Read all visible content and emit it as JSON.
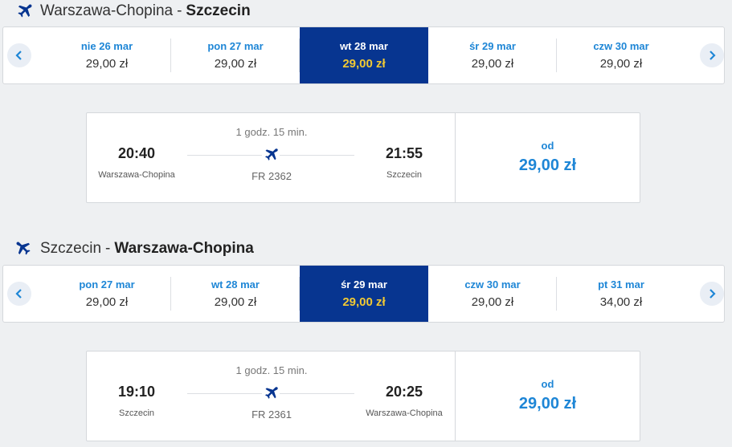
{
  "colors": {
    "accent": "#1e86d6",
    "selected_bg": "#073590",
    "selected_price": "#f1c933"
  },
  "outbound": {
    "origin": "Warszawa-Chopina",
    "separator": "-",
    "destination": "Szczecin",
    "days": [
      {
        "label": "nie 26 mar",
        "price": "29,00 zł"
      },
      {
        "label": "pon 27 mar",
        "price": "29,00 zł"
      },
      {
        "label": "wt 28 mar",
        "price": "29,00 zł"
      },
      {
        "label": "śr 29 mar",
        "price": "29,00 zł"
      },
      {
        "label": "czw 30 mar",
        "price": "29,00 zł"
      }
    ],
    "selected_day": "wt 28 mar",
    "flight": {
      "duration": "1 godz. 15 min.",
      "dep_time": "20:40",
      "dep_city": "Warszawa-Chopina",
      "arr_time": "21:55",
      "arr_city": "Szczecin",
      "flight_number": "FR 2362",
      "from_label": "od",
      "price": "29,00 zł"
    }
  },
  "return": {
    "origin": "Szczecin",
    "separator": "-",
    "destination": "Warszawa-Chopina",
    "days": [
      {
        "label": "pon 27 mar",
        "price": "29,00 zł"
      },
      {
        "label": "wt 28 mar",
        "price": "29,00 zł"
      },
      {
        "label": "śr 29 mar",
        "price": "29,00 zł"
      },
      {
        "label": "czw 30 mar",
        "price": "29,00 zł"
      },
      {
        "label": "pt 31 mar",
        "price": "34,00 zł"
      }
    ],
    "selected_day": "śr 29 mar",
    "flight": {
      "duration": "1 godz. 15 min.",
      "dep_time": "19:10",
      "dep_city": "Szczecin",
      "arr_time": "20:25",
      "arr_city": "Warszawa-Chopina",
      "flight_number": "FR 2361",
      "from_label": "od",
      "price": "29,00 zł"
    }
  }
}
